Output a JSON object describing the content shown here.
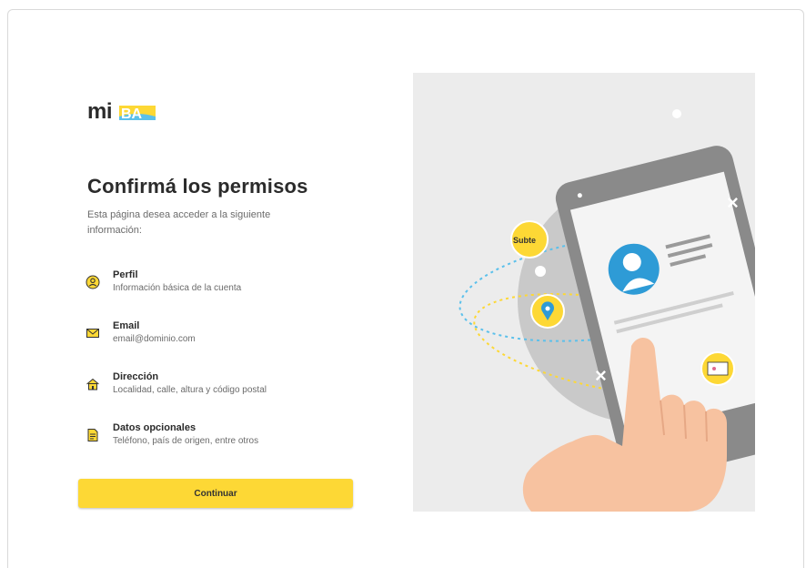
{
  "brand": {
    "logo_text": "mi",
    "logo_accent_text": "BA",
    "accent_color": "#fdd835",
    "secondary_color": "#5bc0eb"
  },
  "page": {
    "title": "Confirmá los permisos",
    "subtitle": "Esta página desea acceder a la siguiente información:"
  },
  "permissions": [
    {
      "icon": "profile-icon",
      "title": "Perfil",
      "description": "Información básica de la cuenta"
    },
    {
      "icon": "envelope-icon",
      "title": "Email",
      "description": "email@dominio.com"
    },
    {
      "icon": "home-icon",
      "title": "Dirección",
      "description": "Localidad, calle, altura y código postal"
    },
    {
      "icon": "document-icon",
      "title": "Datos opcionales",
      "description": "Teléfono, país de origen, entre otros"
    }
  ],
  "actions": {
    "continue_label": "Continuar"
  },
  "illustration": {
    "badge_text": "Subte"
  }
}
